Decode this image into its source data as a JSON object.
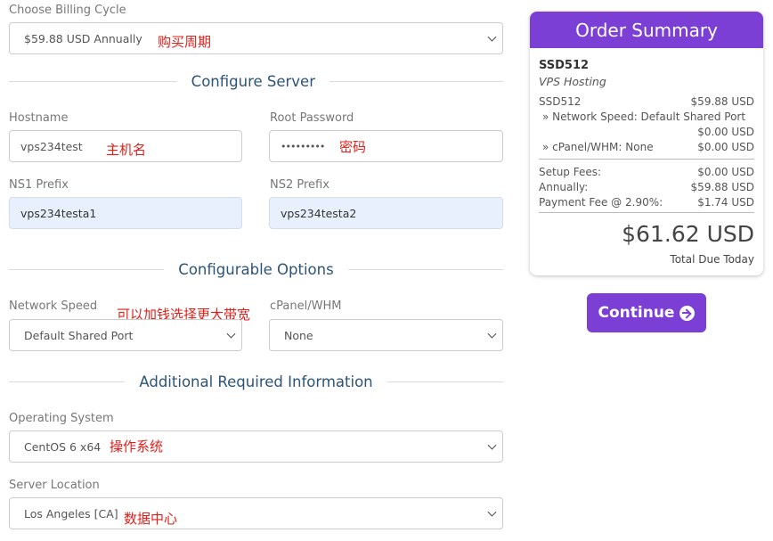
{
  "billing": {
    "label": "Choose Billing Cycle",
    "value": "$59.88 USD Annually",
    "note": "购买周期"
  },
  "configure_server": {
    "title": "Configure Server",
    "hostname_label": "Hostname",
    "hostname_value": "vps234test",
    "hostname_note": "主机名",
    "root_password_label": "Root Password",
    "root_password_value": "•••••••••",
    "root_password_note": "密码",
    "ns1_label": "NS1 Prefix",
    "ns1_value": "vps234testa1",
    "ns2_label": "NS2 Prefix",
    "ns2_value": "vps234testa2"
  },
  "configurable_options": {
    "title": "Configurable Options",
    "network_speed_label": "Network Speed",
    "network_speed_value": "Default Shared Port",
    "network_speed_note": "可以加钱选择更大带宽",
    "cpanel_label": "cPanel/WHM",
    "cpanel_value": "None"
  },
  "additional_info": {
    "title": "Additional Required Information",
    "os_label": "Operating System",
    "os_value": "CentOS 6 x64",
    "os_note": "操作系统",
    "location_label": "Server Location",
    "location_value": "Los Angeles [CA]",
    "location_note": "数据中心"
  },
  "summary": {
    "title": "Order Summary",
    "product_name": "SSD512",
    "product_group": "VPS Hosting",
    "item_name": "SSD512",
    "item_price": "$59.88 USD",
    "option1_label": "» Network Speed: Default Shared Port",
    "option1_price": "$0.00 USD",
    "option2_label": "» cPanel/WHM: None",
    "option2_price": "$0.00 USD",
    "setup_label": "Setup Fees:",
    "setup_price": "$0.00 USD",
    "annual_label": "Annually:",
    "annual_price": "$59.88 USD",
    "payment_fee_label": "Payment Fee @ 2.90%:",
    "payment_fee_price": "$1.74 USD",
    "total": "$61.62 USD",
    "total_label": "Total Due Today"
  },
  "continue_label": "Continue",
  "icons": {
    "continue": "arrow-circle-right-icon",
    "select": "chevron-down-icon"
  },
  "colors": {
    "accent": "#7c3fd6",
    "note": "#e0201b",
    "section_title": "#2c5478"
  }
}
